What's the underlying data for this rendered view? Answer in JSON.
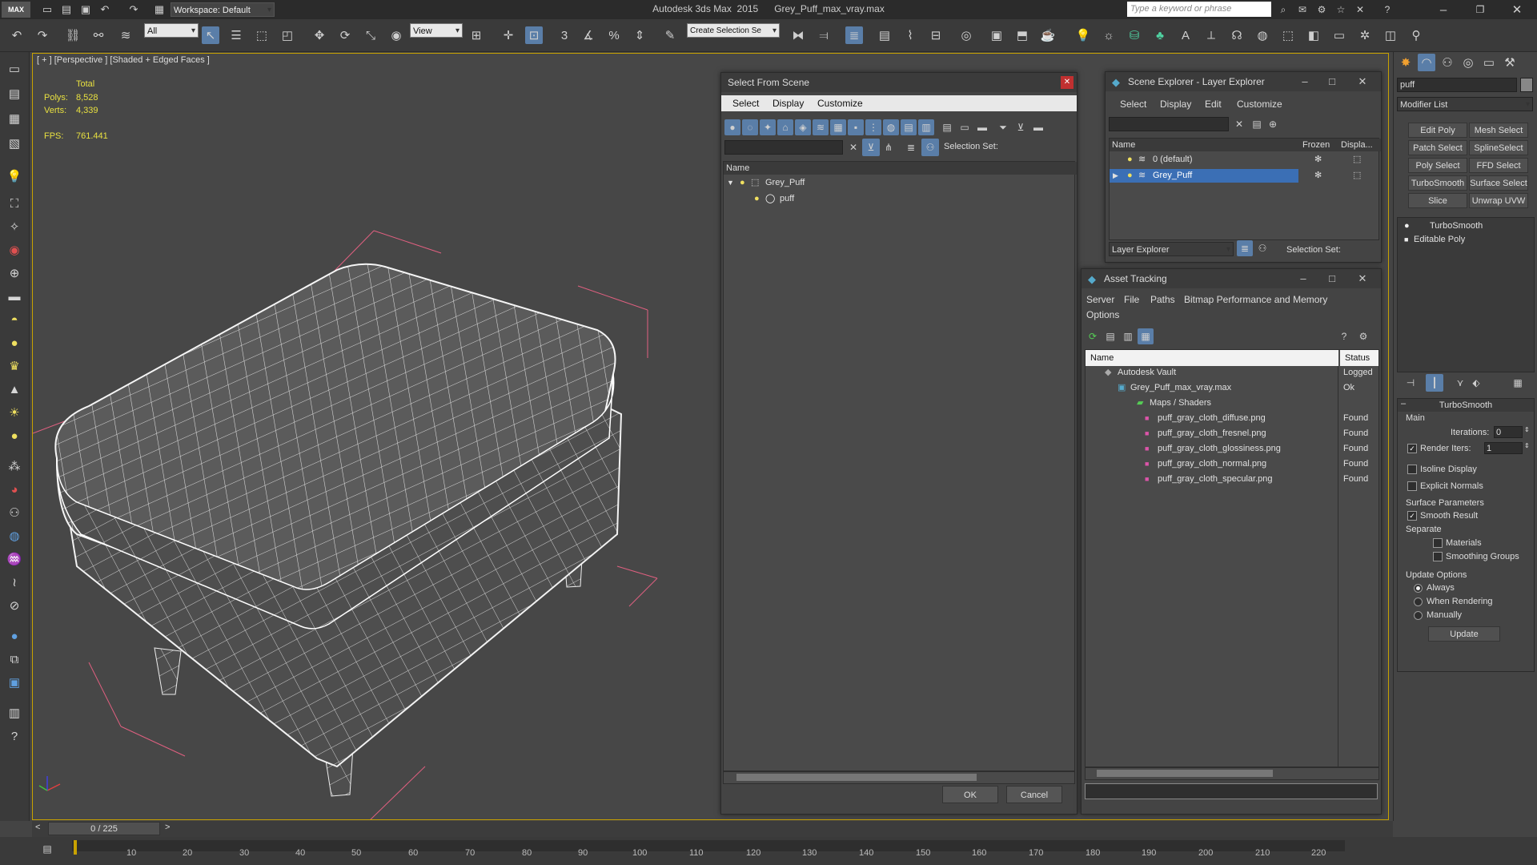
{
  "app": {
    "title": "Autodesk 3ds Max  2015      Grey_Puff_max_vray.max",
    "workspace": "Workspace: Default",
    "search_placeholder": "Type a keyword or phrase",
    "logo": "MAX"
  },
  "toolbar": {
    "filter": "All",
    "refcoord": "View",
    "selection_set": "Create Selection Se",
    "snap_label": "3"
  },
  "viewport": {
    "label": "[ + ] [Perspective ] [Shaded + Edged Faces ]",
    "stats_header": "Total",
    "polys_label": "Polys:",
    "polys_value": "8,528",
    "verts_label": "Verts:",
    "verts_value": "4,339",
    "fps_label": "FPS:",
    "fps_value": "761.441"
  },
  "select_from_scene": {
    "title": "Select From Scene",
    "menu": [
      "Select",
      "Display",
      "Customize"
    ],
    "selection_set_label": "Selection Set:",
    "col_name": "Name",
    "items": [
      {
        "name": "Grey_Puff"
      },
      {
        "name": "puff"
      }
    ],
    "ok": "OK",
    "cancel": "Cancel"
  },
  "scene_explorer": {
    "title": "Scene Explorer - Layer Explorer",
    "menu": [
      "Select",
      "Display",
      "Edit",
      "Customize"
    ],
    "cols": [
      "Name",
      "Frozen",
      "Displa..."
    ],
    "rows": [
      {
        "name": "0 (default)"
      },
      {
        "name": "Grey_Puff"
      }
    ],
    "footer_combo": "Layer Explorer",
    "selection_set_label": "Selection Set:"
  },
  "asset_tracking": {
    "title": "Asset Tracking",
    "menu": [
      "Server",
      "File",
      "Paths",
      "Bitmap Performance and Memory"
    ],
    "menu2": "Options",
    "col_name": "Name",
    "col_status": "Status",
    "rows": [
      {
        "name": "Autodesk Vault",
        "status": "Logged"
      },
      {
        "name": "Grey_Puff_max_vray.max",
        "status": "Ok"
      },
      {
        "name": "Maps / Shaders",
        "status": ""
      },
      {
        "name": "puff_gray_cloth_diffuse.png",
        "status": "Found"
      },
      {
        "name": "puff_gray_cloth_fresnel.png",
        "status": "Found"
      },
      {
        "name": "puff_gray_cloth_glossiness.png",
        "status": "Found"
      },
      {
        "name": "puff_gray_cloth_normal.png",
        "status": "Found"
      },
      {
        "name": "puff_gray_cloth_specular.png",
        "status": "Found"
      }
    ]
  },
  "command_panel": {
    "object_name": "puff",
    "modifier_list": "Modifier List",
    "buttons": [
      "Edit Poly",
      "Mesh Select",
      "Patch Select",
      "SplineSelect",
      "Poly Select",
      "FFD Select",
      "TurboSmooth",
      "Surface Select",
      "Slice",
      "Unwrap UVW"
    ],
    "stack": [
      "TurboSmooth",
      "Editable Poly"
    ],
    "rollout_title": "TurboSmooth",
    "main_label": "Main",
    "iterations_label": "Iterations:",
    "iterations_value": "0",
    "render_iters_label": "Render Iters:",
    "render_iters_value": "1",
    "isoline_display": "Isoline Display",
    "explicit_normals": "Explicit Normals",
    "surface_params": "Surface Parameters",
    "smooth_result": "Smooth Result",
    "separate": "Separate",
    "materials": "Materials",
    "smoothing_groups": "Smoothing Groups",
    "update_options": "Update Options",
    "always": "Always",
    "when_rendering": "When Rendering",
    "manually": "Manually",
    "update_btn": "Update"
  },
  "timeline": {
    "frame": "0 / 225",
    "ticks": [
      "10",
      "20",
      "30",
      "40",
      "50",
      "60",
      "70",
      "80",
      "90",
      "100",
      "110",
      "120",
      "130",
      "140",
      "150",
      "160",
      "170",
      "180",
      "190",
      "200",
      "210",
      "220"
    ]
  }
}
